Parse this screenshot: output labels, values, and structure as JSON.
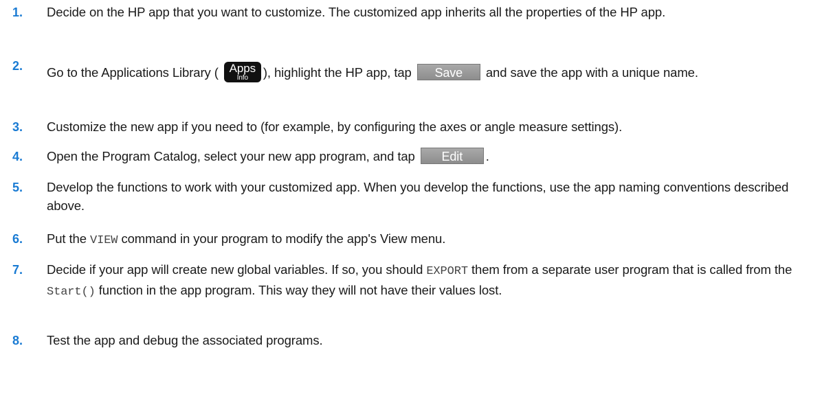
{
  "steps": [
    {
      "number": "1.",
      "text": "Decide on the HP app that you want to customize. The customized app inherits all the properties of the HP app."
    },
    {
      "number": "2.",
      "text_before": "Go to the Applications Library (",
      "apps_key": {
        "main": "Apps",
        "sub": "Info"
      },
      "text_middle": "), highlight the HP app, tap",
      "save_key": "Save",
      "text_after": "and save the app with a unique name."
    },
    {
      "number": "3.",
      "text": "Customize the new app if you need to (for example, by configuring the axes or angle measure settings)."
    },
    {
      "number": "4.",
      "text_before": "Open the Program Catalog, select your new app program, and tap",
      "edit_key": "Edit",
      "text_after": "."
    },
    {
      "number": "5.",
      "text": "Develop the functions to work with your customized app. When you develop the functions, use the app naming conventions described above."
    },
    {
      "number": "6.",
      "text_before": "Put the",
      "code": "VIEW",
      "text_after": "command in your program to modify the app's View menu."
    },
    {
      "number": "7.",
      "text_before": "Decide if your app will create new global variables. If so, you should",
      "code1": "EXPORT",
      "text_middle": "them from a separate user program that is called from the",
      "code2": "Start()",
      "text_after": "function in the app program. This way they will not have their values lost."
    },
    {
      "number": "8.",
      "text": "Test the app and debug the associated programs."
    }
  ],
  "colors": {
    "step_number": "#1a7bd3",
    "softkey": "#9a9a9a",
    "apps_key": "#111111"
  }
}
